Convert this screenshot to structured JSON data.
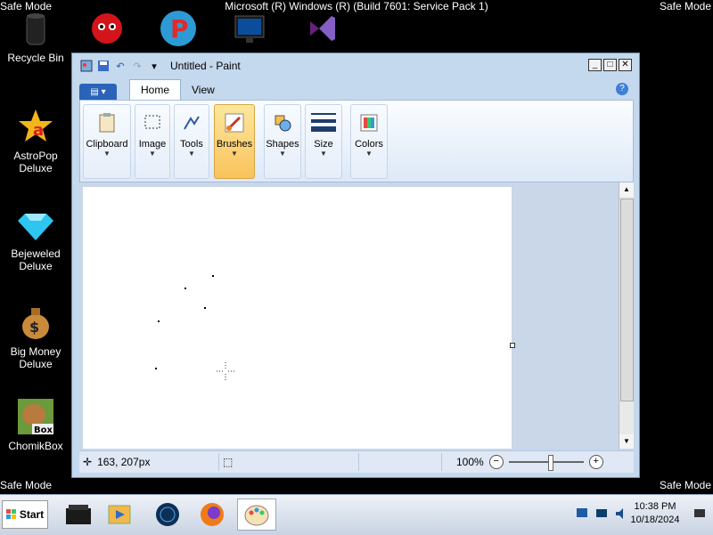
{
  "desktop": {
    "os_title": "Microsoft (R) Windows (R) (Build 7601: Service Pack 1)",
    "safe_mode_label": "Safe Mode",
    "icons": [
      {
        "label": "Recycle Bin",
        "icon": "recycle-bin-icon"
      },
      {
        "label": "AstroPop Deluxe",
        "icon": "astropop-icon"
      },
      {
        "label": "Bejeweled Deluxe",
        "icon": "bejeweled-icon"
      },
      {
        "label": "Big Money Deluxe",
        "icon": "money-bag-icon"
      },
      {
        "label": "ChomikBox",
        "icon": "chomikbox-icon"
      }
    ],
    "top_icons": [
      "red-fuzzball-icon",
      "popcap-icon",
      "monitor-icon",
      "visual-studio-icon"
    ]
  },
  "paint": {
    "title": "Untitled - Paint",
    "tabs": [
      {
        "label": "Home",
        "active": true
      },
      {
        "label": "View",
        "active": false
      }
    ],
    "groups": [
      {
        "label": "Clipboard",
        "icon": "clipboard-icon"
      },
      {
        "label": "Image",
        "icon": "select-icon"
      },
      {
        "label": "Tools",
        "icon": "pencil-icon"
      },
      {
        "label": "Brushes",
        "icon": "brush-icon",
        "selected": true
      },
      {
        "label": "Shapes",
        "icon": "shapes-icon"
      },
      {
        "label": "Size",
        "icon": "size-icon"
      },
      {
        "label": "Colors",
        "icon": "palette-icon"
      }
    ],
    "status": {
      "coords": "163, 207px",
      "zoom": "100%"
    }
  },
  "taskbar": {
    "start_label": "Start",
    "time": "10:38 PM",
    "date": "10/18/2024",
    "apps": [
      "explorer-icon",
      "media-player-icon",
      "globe-icon",
      "firefox-icon",
      "paint-icon"
    ]
  },
  "colors": {
    "window_frame": "#c4d8ee",
    "selected_group": "#f9c35c",
    "canvas": "#ffffff"
  }
}
